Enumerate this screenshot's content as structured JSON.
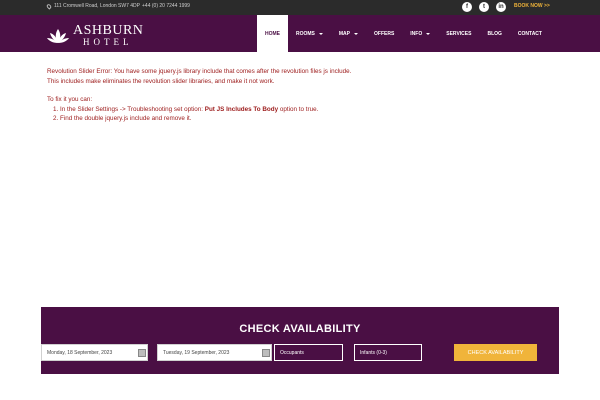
{
  "topbar": {
    "address": "111 Cromwell Road, London SW7 4DP",
    "phone": "+44 (0) 20 7244 1999",
    "social": [
      {
        "icon": "facebook-icon",
        "glyph": "f"
      },
      {
        "icon": "twitter-icon",
        "glyph": "t"
      },
      {
        "icon": "linkedin-icon",
        "glyph": "in"
      }
    ],
    "book_now": "BOOK NOW >>"
  },
  "header": {
    "logo_main": "ASHBURN",
    "logo_sub": "HOTEL",
    "nav": [
      {
        "label": "HOME",
        "active": true,
        "dropdown": false
      },
      {
        "label": "ROOMS",
        "active": false,
        "dropdown": true
      },
      {
        "label": "MAP",
        "active": false,
        "dropdown": true
      },
      {
        "label": "OFFERS",
        "active": false,
        "dropdown": false
      },
      {
        "label": "INFO",
        "active": false,
        "dropdown": true
      },
      {
        "label": "SERVICES",
        "active": false,
        "dropdown": false
      },
      {
        "label": "BLOG",
        "active": false,
        "dropdown": false
      },
      {
        "label": "CONTACT",
        "active": false,
        "dropdown": false
      }
    ]
  },
  "error": {
    "line1": "Revolution Slider Error: You have some jquery.js library include that comes after the revolution files js include.",
    "line2": "This includes make eliminates the revolution slider libraries, and make it not work.",
    "fix_intro": "To fix it you can:",
    "step1_prefix": "In the Slider Settings -> Troubleshooting set option:",
    "step1_bold": "Put JS Includes To Body",
    "step1_suffix": "option to true.",
    "step2": "Find the double jquery.js include and remove it."
  },
  "availability": {
    "title": "CHECK AVAILABILITY",
    "checkin": "Monday, 18 September, 2023",
    "checkout": "Tuesday, 19 September, 2023",
    "occupants": "Occupants",
    "infants": "Infants (0-3)",
    "button": "CHECK AVAILABILITY"
  },
  "colors": {
    "brand": "#4a0f44",
    "accent": "#f0b43a",
    "error": "#9c1a1a",
    "topbar": "#2b2b2b"
  }
}
